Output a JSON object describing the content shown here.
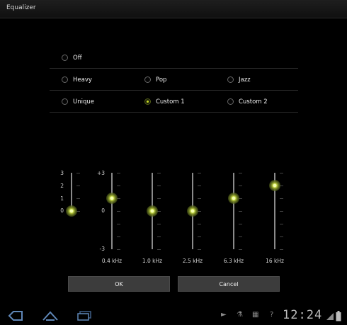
{
  "window": {
    "title": "Equalizer"
  },
  "presets": {
    "rows": [
      [
        {
          "label": "Off",
          "checked": false
        }
      ],
      [
        {
          "label": "Heavy",
          "checked": false
        },
        {
          "label": "Pop",
          "checked": false
        },
        {
          "label": "Jazz",
          "checked": false
        }
      ],
      [
        {
          "label": "Unique",
          "checked": false
        },
        {
          "label": "Custom 1",
          "checked": true
        },
        {
          "label": "Custom 2",
          "checked": false
        }
      ]
    ]
  },
  "equalizer": {
    "preamp_scale": [
      "3",
      "2",
      "1",
      "0"
    ],
    "preamp_level": 0,
    "band_scale": {
      "max": "+3",
      "mid": "0",
      "min": "-3"
    },
    "bands": [
      {
        "freq": "0.4 kHz",
        "level": 1
      },
      {
        "freq": "1.0 kHz",
        "level": 0
      },
      {
        "freq": "2.5 kHz",
        "level": 0
      },
      {
        "freq": "6.3 kHz",
        "level": 1
      },
      {
        "freq": "16 kHz",
        "level": 2
      }
    ],
    "accent_color": "#c8dc28"
  },
  "buttons": {
    "ok": "OK",
    "cancel": "Cancel"
  },
  "statusbar": {
    "time": "12:24"
  },
  "icons": {
    "back": "back-icon",
    "home": "home-icon",
    "recent": "recent-apps-icon",
    "usb": "usb-icon",
    "debug": "debug-icon",
    "notification": "notification-icon",
    "help": "help-icon",
    "signal": "signal-icon",
    "battery": "battery-icon"
  }
}
